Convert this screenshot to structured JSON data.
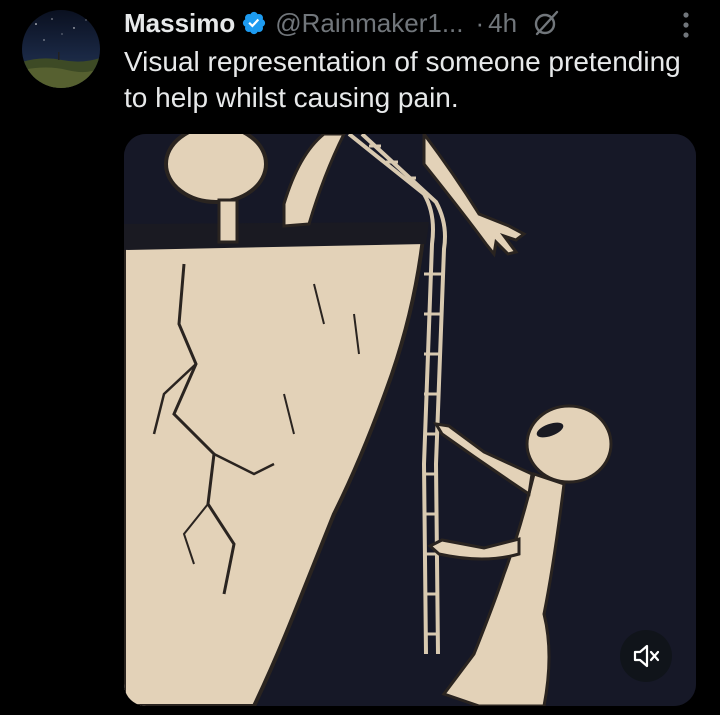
{
  "tweet": {
    "author": {
      "display_name": "Massimo",
      "handle": "@Rainmaker1...",
      "verified": true
    },
    "separator": "·",
    "timestamp": "4h",
    "text": "Visual representation of someone pretending to help whilst causing pain.",
    "media": {
      "type": "video",
      "muted": true
    }
  },
  "icons": {
    "verified": "verified-badge-icon",
    "grok": "grok-icon",
    "more": "more-options-icon",
    "mute": "volume-muted-icon"
  },
  "colors": {
    "background": "#000000",
    "text_primary": "#e7e9ea",
    "text_secondary": "#71767b",
    "verified_blue": "#1d9bf0"
  }
}
